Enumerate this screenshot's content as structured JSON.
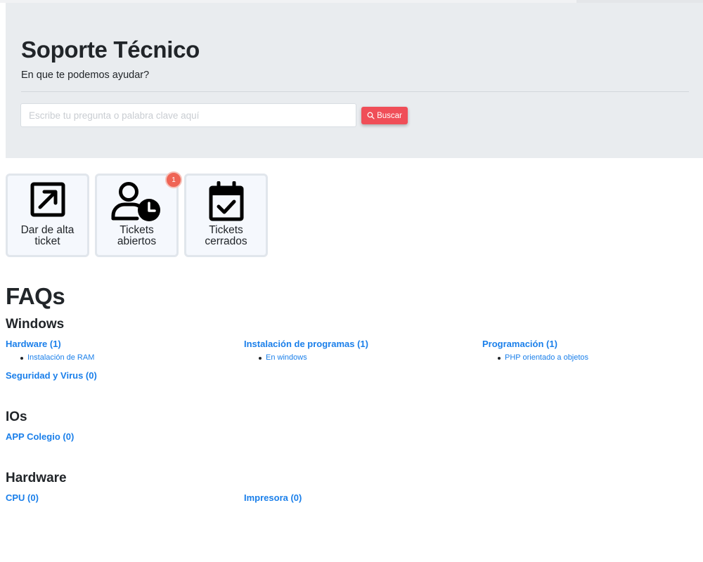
{
  "header": {
    "title": "Soporte Técnico",
    "subtitle": "En que te podemos ayudar?",
    "search_placeholder": "Escribe tu pregunta o palabra clave aquí",
    "search_button": "Buscar"
  },
  "tiles": [
    {
      "label_line1": "Dar de alta",
      "label_line2": "ticket",
      "icon": "external-link-icon"
    },
    {
      "label_line1": "Tickets",
      "label_line2": "abiertos",
      "icon": "user-clock-icon",
      "badge": "1"
    },
    {
      "label_line1": "Tickets",
      "label_line2": "cerrados",
      "icon": "calendar-check-icon"
    }
  ],
  "faq_title": "FAQs",
  "categories": {
    "windows": {
      "title": "Windows",
      "hardware": "Hardware (1)",
      "hardware_item": "Instalación de RAM",
      "instalacion": "Instalación de programas (1)",
      "instalacion_item": "En windows",
      "programacion": "Programación (1)",
      "programacion_item": "PHP orientado a objetos",
      "seguridad": "Seguridad y Virus (0)"
    },
    "ios": {
      "title": "IOs",
      "app": "APP Colegio (0)"
    },
    "hardware": {
      "title": "Hardware",
      "cpu": "CPU (0)",
      "impresora": "Impresora (0)"
    }
  },
  "colors": {
    "accent_link": "#1a7fea",
    "search_button": "#f04e58",
    "badge": "#ef6455",
    "jumbotron": "#e9ecef"
  }
}
